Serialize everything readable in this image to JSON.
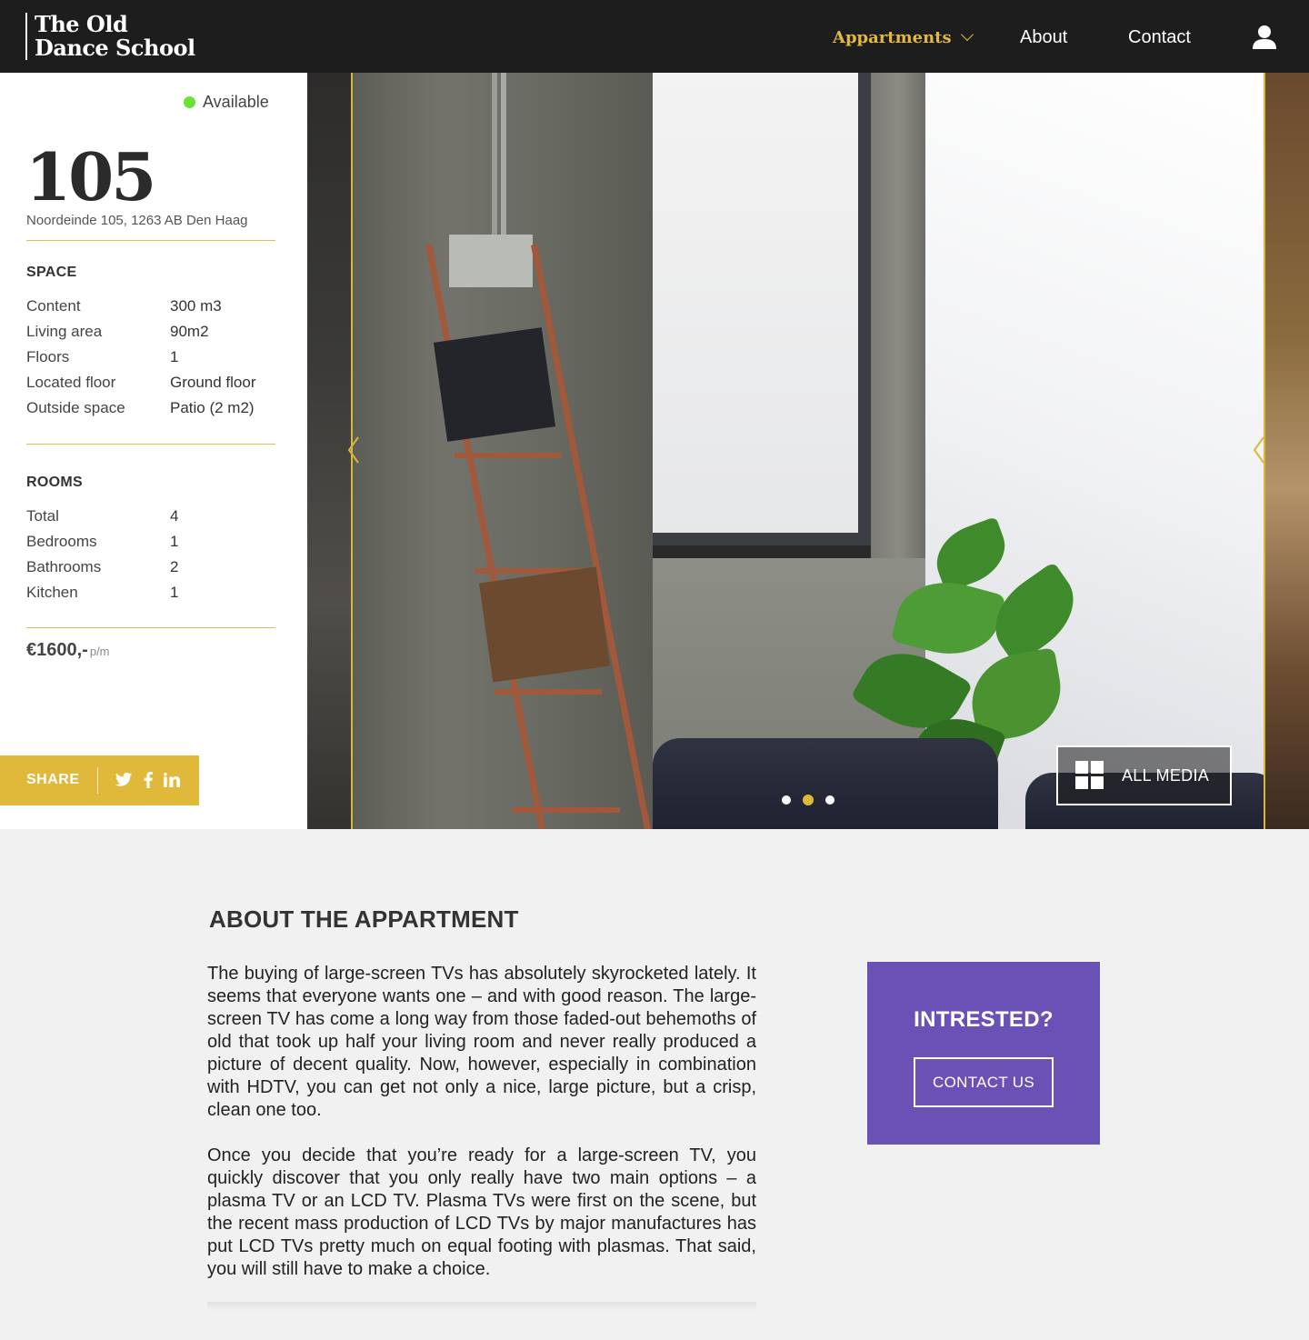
{
  "header": {
    "logo_line1": "The Old",
    "logo_line2": "Dance School",
    "nav": [
      {
        "label": "Appartments",
        "active": true
      },
      {
        "label": "About"
      },
      {
        "label": "Contact"
      }
    ],
    "user_icon": "user-icon"
  },
  "listing": {
    "status": "Available",
    "status_color": "#6be035",
    "number": "105",
    "address": "Noordeinde 105, 1263 AB Den Haag",
    "space": {
      "title": "SPACE",
      "rows": [
        {
          "label": "Content",
          "value": "300 m3"
        },
        {
          "label": "Living area",
          "value": "90m2"
        },
        {
          "label": "Floors",
          "value": "1"
        },
        {
          "label": "Located floor",
          "value": "Ground floor"
        },
        {
          "label": "Outside space",
          "value": "Patio (2 m2)"
        }
      ]
    },
    "rooms": {
      "title": "ROOMS",
      "rows": [
        {
          "label": "Total",
          "value": "4"
        },
        {
          "label": "Bedrooms",
          "value": "1"
        },
        {
          "label": "Bathrooms",
          "value": "2"
        },
        {
          "label": "Kitchen",
          "value": "1"
        }
      ]
    },
    "price": "€1600,-",
    "price_unit": "p/m",
    "share": {
      "label": "SHARE",
      "icons": [
        "twitter-icon",
        "facebook-icon",
        "linkedin-icon"
      ],
      "color": "#e0b93a"
    }
  },
  "gallery": {
    "all_media_label": "ALL MEDIA",
    "slides": 3,
    "active_slide": 2,
    "accent": "#d8b83c"
  },
  "about": {
    "title": "ABOUT THE APPARTMENT",
    "paragraphs": [
      "The buying of large-screen TVs has absolutely skyrocketed lately. It seems that everyone wants one – and with good reason. The large-screen TV has come a long way from those faded-out behemoths of old that took up half your living room and never really produced a picture of decent quality. Now, however, especially in combination with HDTV, you can get not only a nice, large picture, but a crisp, clean one too.",
      "Once you decide that you’re ready for a large-screen TV, you quickly discover that you only really have two main options – a plasma TV or an LCD TV. Plasma TVs were first on the scene, but the recent mass production of LCD TVs by major manufactures has put LCD TVs pretty much on equal footing with plasmas. That said, you will still have to make a choice."
    ]
  },
  "cta": {
    "title": "INTRESTED?",
    "button": "CONTACT US",
    "color": "#6a51b6"
  }
}
